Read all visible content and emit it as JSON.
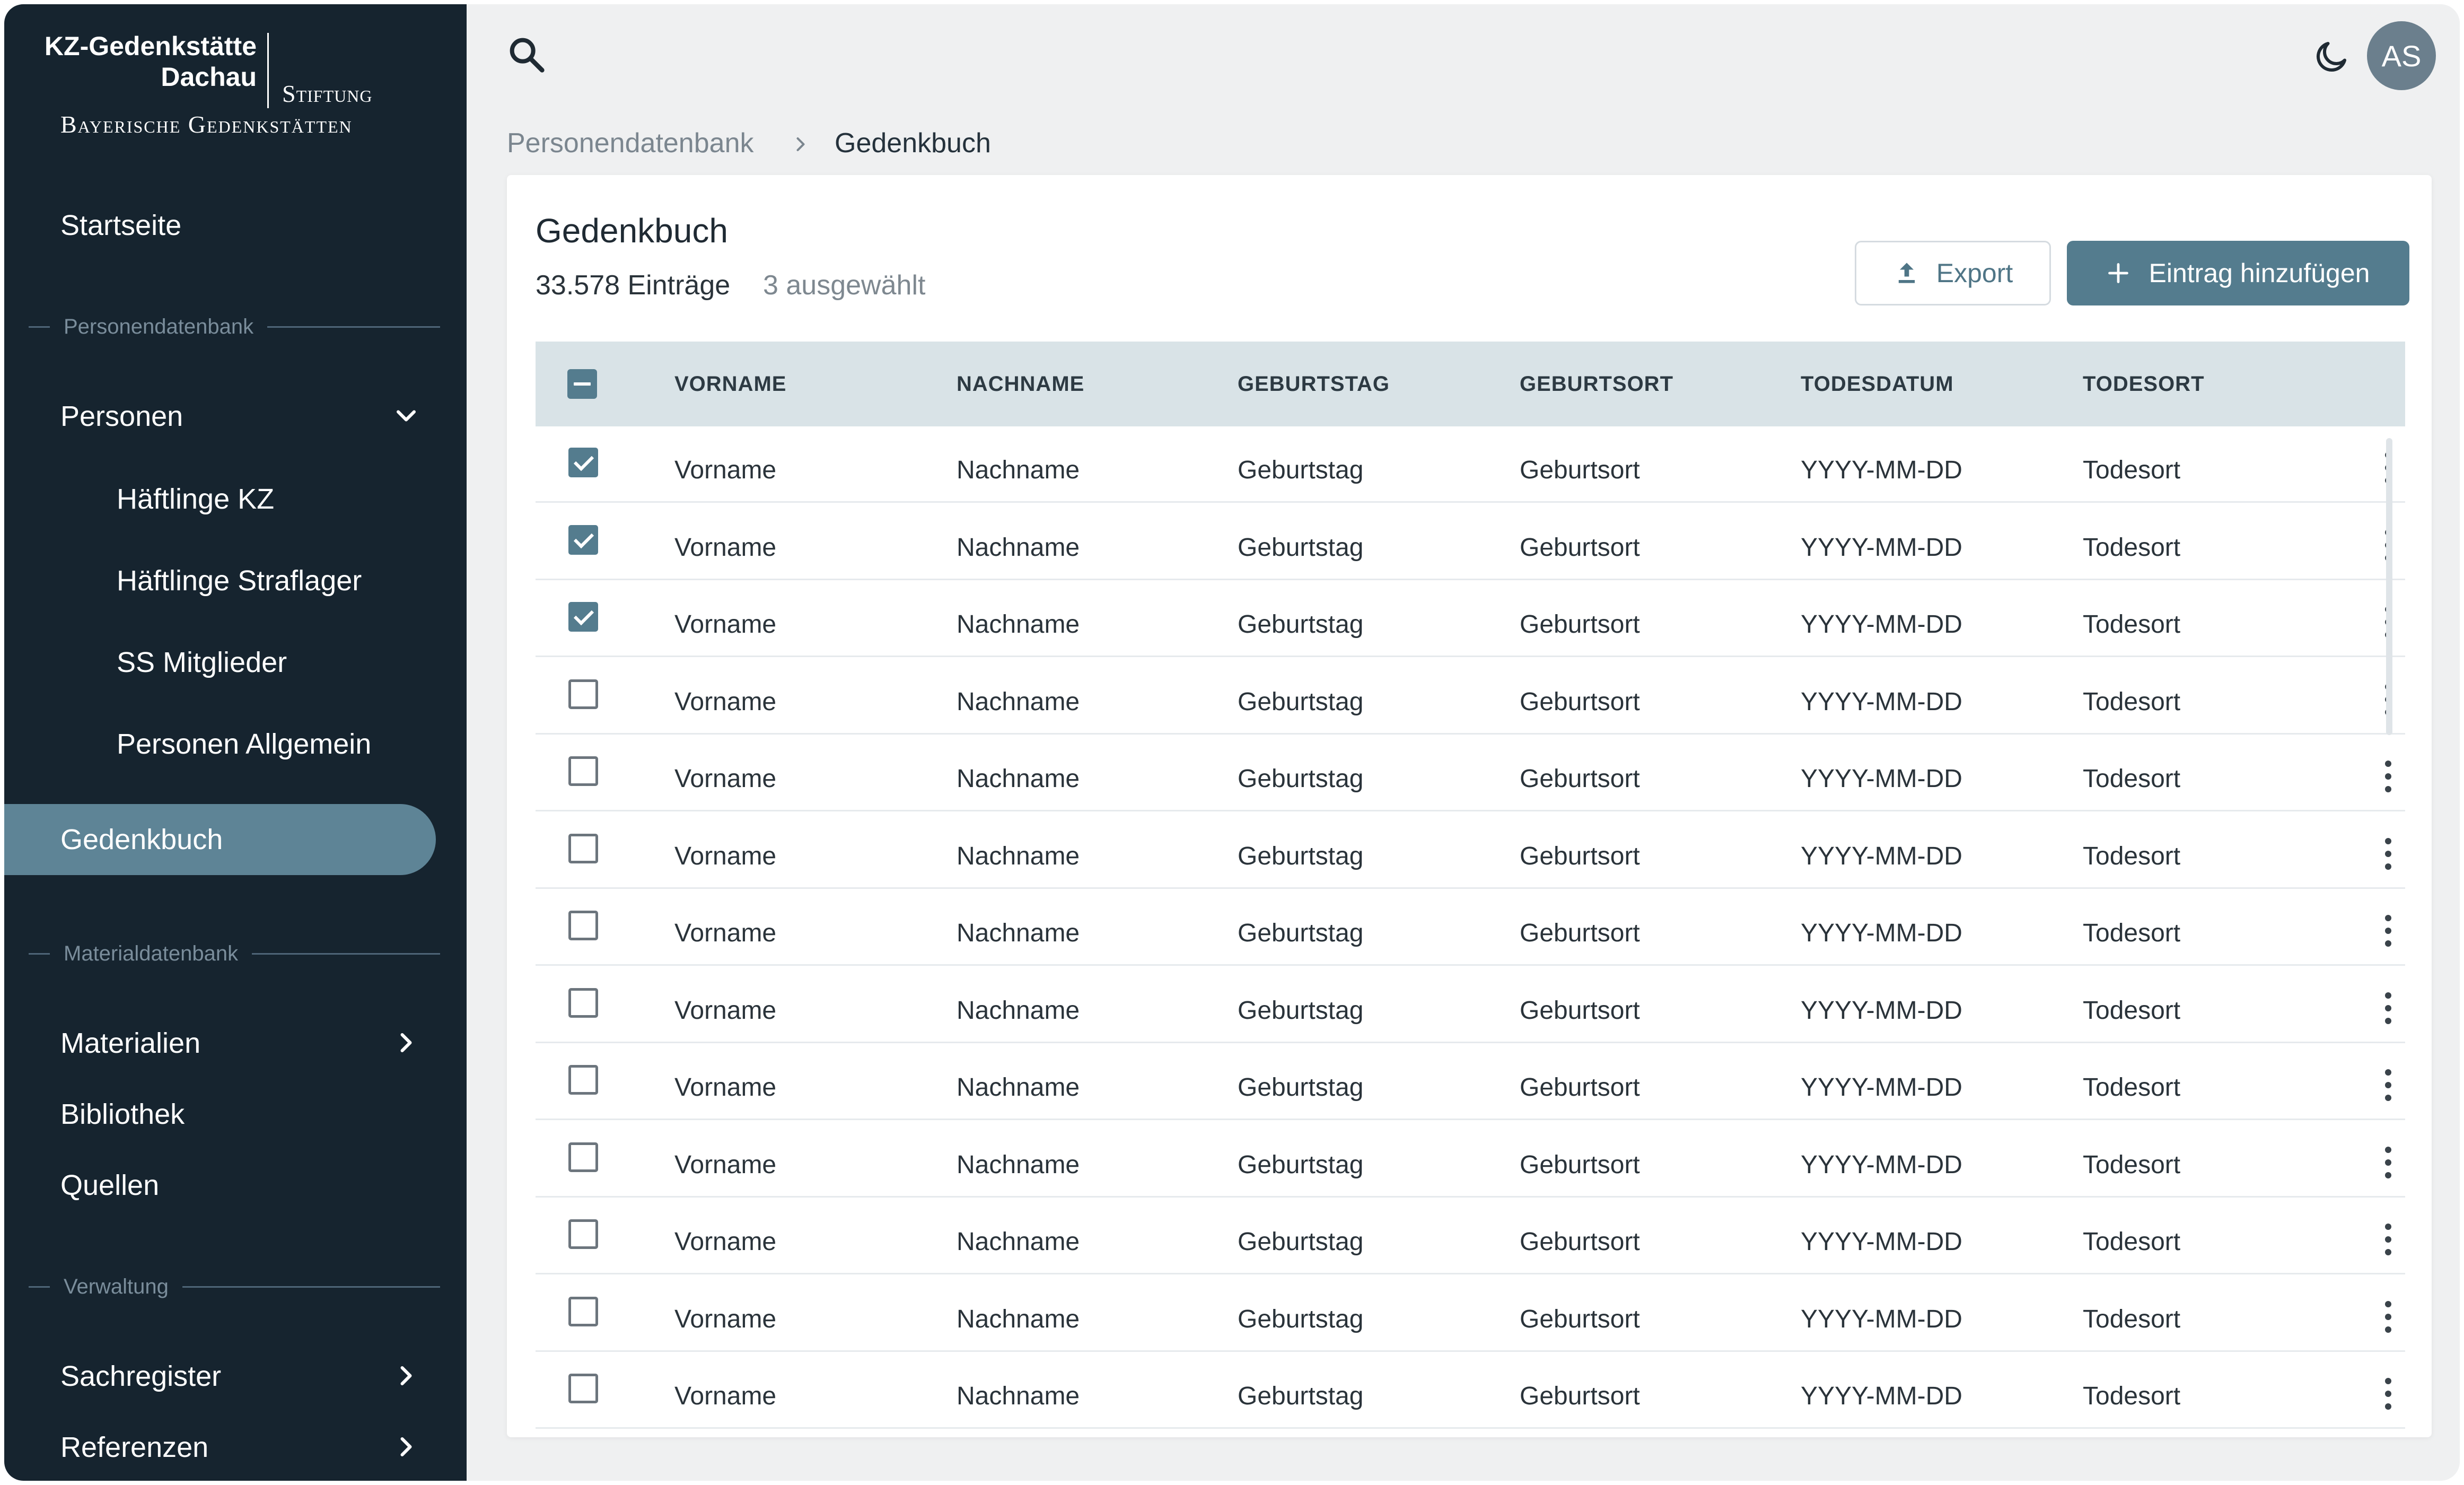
{
  "logo": {
    "line1": "KZ-Gedenkstätte",
    "line2": "Dachau",
    "line3": "Stiftung",
    "line4": "Bayerische Gedenkstätten"
  },
  "sidebar": {
    "startseite": "Startseite",
    "section_personen": "Personendatenbank",
    "personen": "Personen",
    "haeftlinge_kz": "Häftlinge KZ",
    "haeftlinge_straflager": "Häftlinge Straflager",
    "ss_mitglieder": "SS Mitglieder",
    "personen_allgemein": "Personen Allgemein",
    "gedenkbuch": "Gedenkbuch",
    "section_material": "Materialdatenbank",
    "materialien": "Materialien",
    "bibliothek": "Bibliothek",
    "quellen": "Quellen",
    "section_verwaltung": "Verwaltung",
    "sachregister": "Sachregister",
    "referenzen": "Referenzen"
  },
  "topbar": {
    "avatar_initials": "AS",
    "search_icon": "search-icon",
    "theme_icon": "moon-icon"
  },
  "breadcrumb": {
    "parent": "Personendatenbank",
    "current": "Gedenkbuch"
  },
  "card": {
    "title": "Gedenkbuch",
    "count": "33.578 Einträge",
    "selected": "3 ausgewählt",
    "export_label": "Export",
    "add_label": "Eintrag hinzufügen"
  },
  "table": {
    "columns": [
      "VORNAME",
      "NACHNAME",
      "GEBURTSTAG",
      "GEBURTSORT",
      "TODESDATUM",
      "TODESORT"
    ],
    "rows": [
      {
        "checked": true,
        "cells": [
          "Vorname",
          "Nachname",
          "Geburtstag",
          "Geburtsort",
          "YYYY-MM-DD",
          "Todesort"
        ]
      },
      {
        "checked": true,
        "cells": [
          "Vorname",
          "Nachname",
          "Geburtstag",
          "Geburtsort",
          "YYYY-MM-DD",
          "Todesort"
        ]
      },
      {
        "checked": true,
        "cells": [
          "Vorname",
          "Nachname",
          "Geburtstag",
          "Geburtsort",
          "YYYY-MM-DD",
          "Todesort"
        ]
      },
      {
        "checked": false,
        "cells": [
          "Vorname",
          "Nachname",
          "Geburtstag",
          "Geburtsort",
          "YYYY-MM-DD",
          "Todesort"
        ]
      },
      {
        "checked": false,
        "cells": [
          "Vorname",
          "Nachname",
          "Geburtstag",
          "Geburtsort",
          "YYYY-MM-DD",
          "Todesort"
        ]
      },
      {
        "checked": false,
        "cells": [
          "Vorname",
          "Nachname",
          "Geburtstag",
          "Geburtsort",
          "YYYY-MM-DD",
          "Todesort"
        ]
      },
      {
        "checked": false,
        "cells": [
          "Vorname",
          "Nachname",
          "Geburtstag",
          "Geburtsort",
          "YYYY-MM-DD",
          "Todesort"
        ]
      },
      {
        "checked": false,
        "cells": [
          "Vorname",
          "Nachname",
          "Geburtstag",
          "Geburtsort",
          "YYYY-MM-DD",
          "Todesort"
        ]
      },
      {
        "checked": false,
        "cells": [
          "Vorname",
          "Nachname",
          "Geburtstag",
          "Geburtsort",
          "YYYY-MM-DD",
          "Todesort"
        ]
      },
      {
        "checked": false,
        "cells": [
          "Vorname",
          "Nachname",
          "Geburtstag",
          "Geburtsort",
          "YYYY-MM-DD",
          "Todesort"
        ]
      },
      {
        "checked": false,
        "cells": [
          "Vorname",
          "Nachname",
          "Geburtstag",
          "Geburtsort",
          "YYYY-MM-DD",
          "Todesort"
        ]
      },
      {
        "checked": false,
        "cells": [
          "Vorname",
          "Nachname",
          "Geburtstag",
          "Geburtsort",
          "YYYY-MM-DD",
          "Todesort"
        ]
      },
      {
        "checked": false,
        "cells": [
          "Vorname",
          "Nachname",
          "Geburtstag",
          "Geburtsort",
          "YYYY-MM-DD",
          "Todesort"
        ]
      }
    ]
  },
  "colors": {
    "sidebar_bg": "#16242f",
    "accent": "#547c8e",
    "active_nav": "#5e8496",
    "header_row": "#d9e3e7"
  }
}
